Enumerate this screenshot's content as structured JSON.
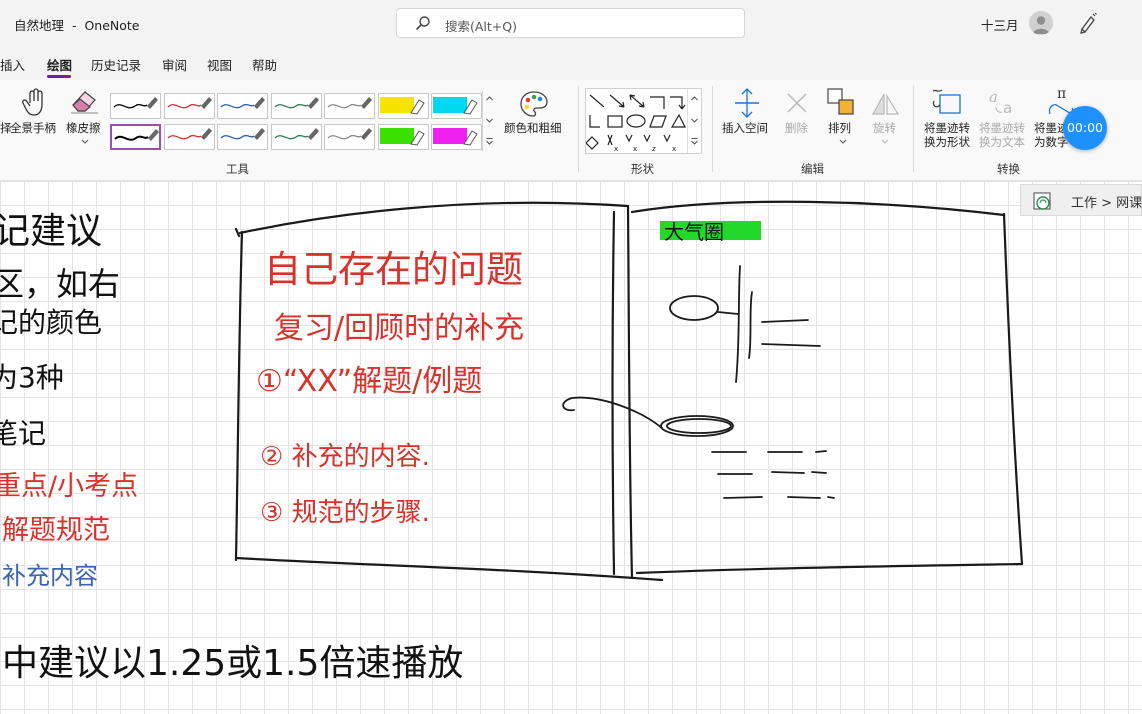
{
  "window": {
    "notebook": "自然地理",
    "separator": "-",
    "app": "OneNote"
  },
  "search": {
    "placeholder": "搜索(Alt+Q)"
  },
  "account": {
    "user_name": "十三月"
  },
  "menubar": {
    "items": [
      "插入",
      "绘图",
      "历史记录",
      "审阅",
      "视图",
      "帮助"
    ],
    "active": "绘图"
  },
  "ribbon": {
    "tools": {
      "lasso_partial": "择",
      "pan_label": "全景手柄",
      "eraser_label": "橡皮擦",
      "pens": [
        {
          "color": "#000000",
          "kind": "pen"
        },
        {
          "color": "#d32f2f",
          "kind": "pen"
        },
        {
          "color": "#2b5fb0",
          "kind": "pen"
        },
        {
          "color": "#2e7d4f",
          "kind": "pen"
        },
        {
          "color": "#8a8a8a",
          "kind": "pen"
        },
        {
          "color": "#f5e400",
          "kind": "highlighter"
        },
        {
          "color": "#00d8f0",
          "kind": "highlighter"
        },
        {
          "color": "#000000",
          "kind": "pen",
          "selected": true
        },
        {
          "color": "#d32f2f",
          "kind": "pen"
        },
        {
          "color": "#2b5fb0",
          "kind": "pen"
        },
        {
          "color": "#2e7d4f",
          "kind": "pen"
        },
        {
          "color": "#8a8a8a",
          "kind": "pen"
        },
        {
          "color": "#39e000",
          "kind": "highlighter"
        },
        {
          "color": "#f020f0",
          "kind": "highlighter"
        }
      ],
      "color_thickness_label": "颜色和粗细",
      "group_label": "工具"
    },
    "shapes": {
      "group_label": "形状"
    },
    "edit": {
      "insert_space_label": "插入空间",
      "delete_label": "删除",
      "arrange_label": "排列",
      "rotate_label": "旋转",
      "group_label": "编辑"
    },
    "convert": {
      "ink_to_shape_line1": "将墨迹转",
      "ink_to_shape_line2": "换为形状",
      "ink_to_text_line1": "将墨迹转",
      "ink_to_text_line2": "换为文本",
      "ink_to_math_line1": "将墨迹",
      "ink_to_math_line2": "为数字",
      "group_label": "转换"
    }
  },
  "timer": {
    "value": "00:00"
  },
  "breadcrumb": {
    "text": "工作 > 网课"
  },
  "note": {
    "left_column": [
      {
        "text": "记建议",
        "color": "#111111"
      },
      {
        "text": "区，如右",
        "color": "#111111"
      },
      {
        "text": "记的颜色",
        "color": "#111111"
      },
      {
        "text": "为3种",
        "color": "#111111"
      },
      {
        "text": "笔记",
        "color": "#111111"
      },
      {
        "text": "重点/小考点",
        "color": "#d8322a"
      },
      {
        "text": "解题规范",
        "color": "#d8322a"
      },
      {
        "text": "补充内容",
        "color": "#3a63b0"
      }
    ],
    "bottom_line": "中建议以1.25或1.5倍速播放",
    "book_left": {
      "line1": "自己存在的问题",
      "line2": "复习/回顾时的补充",
      "item1": "①“XX”解题/例题",
      "item2": "② 补充的内容.",
      "item3": "③ 规范的步骤."
    },
    "book_right": {
      "highlight": "大气圈",
      "highlight_color": "#22d82a"
    },
    "ink_colors": {
      "black": "#111111",
      "red": "#d8322a",
      "blue": "#3a63b0"
    }
  }
}
